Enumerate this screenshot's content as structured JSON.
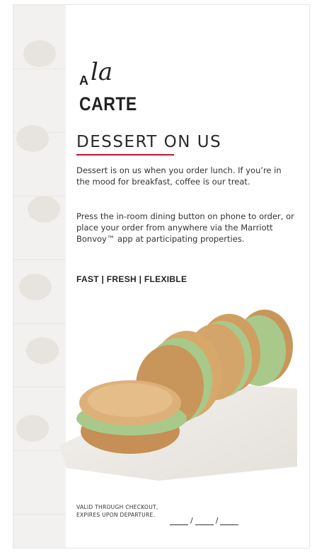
{
  "logo": {
    "a": "A",
    "la": "la",
    "carte": "CARTE"
  },
  "title": "DESSERT ON US",
  "paragraph1": "Dessert is on us when you order lunch. If you’re in the mood for breakfast, coffee is our treat.",
  "paragraph2": "Press the in-room dining button on phone to order, or place your order from anywhere via the Marriott Bonvoy™ app at participating properties.",
  "tagline": "FAST | FRESH | FLEXIBLE",
  "fine_print": "VALID THROUGH CHECKOUT, EXPIRES UPON DEPARTURE.",
  "date_separator": "/",
  "colors": {
    "accent": "#c8102e",
    "text": "#2a2a2a",
    "stripe": "#f3f1ef",
    "cookie": "#d7a86a",
    "pistachio": "#a9c98a"
  }
}
